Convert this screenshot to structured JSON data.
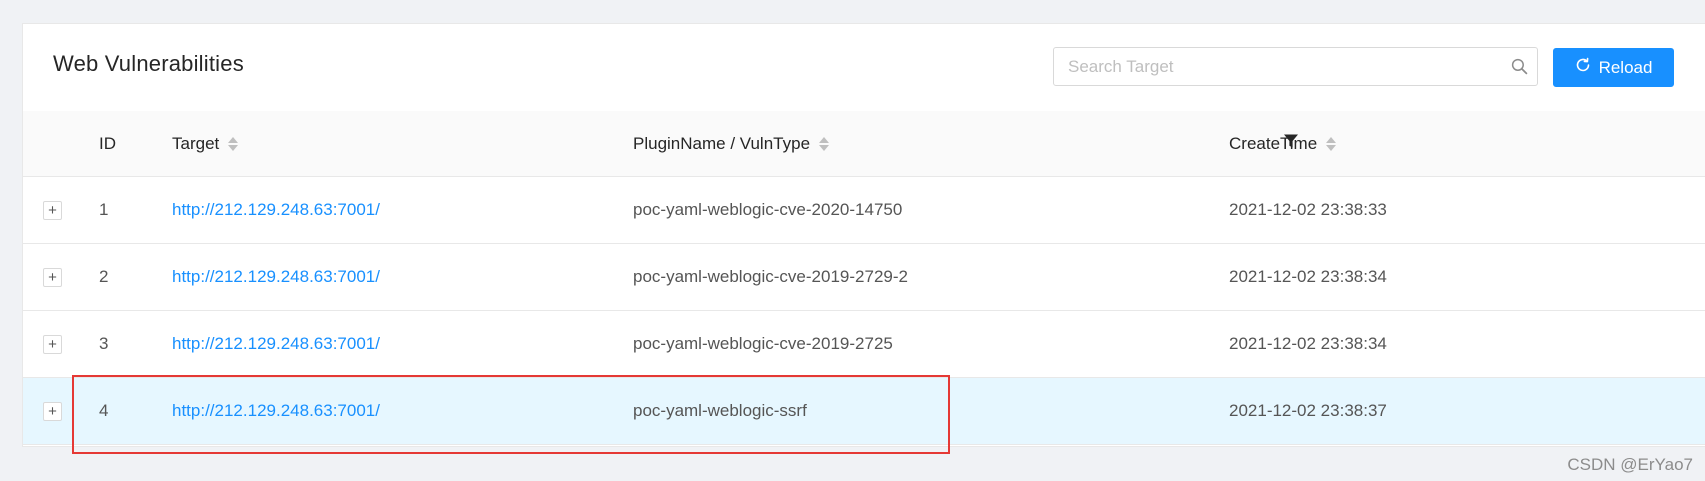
{
  "page": {
    "title": "Web Vulnerabilities",
    "search_placeholder": "Search Target",
    "search_value": "",
    "reload_label": "Reload"
  },
  "icons": {
    "search": "search-icon",
    "reload": "reload-icon",
    "filter": "filter-icon",
    "expand": "plus-icon"
  },
  "colors": {
    "primary": "#1890ff",
    "selected_row": "#e6f7ff",
    "highlight_box": "#e53935"
  },
  "table": {
    "columns": {
      "id": "ID",
      "target": "Target",
      "plugin": "PluginName / VulnType",
      "create_time": "CreateTime"
    },
    "rows": [
      {
        "expand": "+",
        "id": "1",
        "target": "http://212.129.248.63:7001/",
        "plugin": "poc-yaml-weblogic-cve-2020-14750",
        "create_time": "2021-12-02 23:38:33"
      },
      {
        "expand": "+",
        "id": "2",
        "target": "http://212.129.248.63:7001/",
        "plugin": "poc-yaml-weblogic-cve-2019-2729-2",
        "create_time": "2021-12-02 23:38:34"
      },
      {
        "expand": "+",
        "id": "3",
        "target": "http://212.129.248.63:7001/",
        "plugin": "poc-yaml-weblogic-cve-2019-2725",
        "create_time": "2021-12-02 23:38:34"
      },
      {
        "expand": "+",
        "id": "4",
        "target": "http://212.129.248.63:7001/",
        "plugin": "poc-yaml-weblogic-ssrf",
        "create_time": "2021-12-02 23:38:37"
      }
    ]
  },
  "watermark": "CSDN @ErYao7"
}
